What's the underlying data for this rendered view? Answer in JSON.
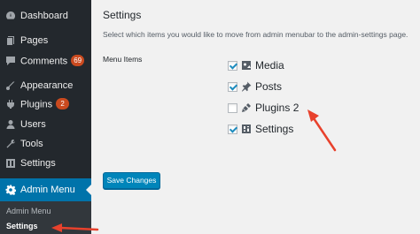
{
  "sidebar": {
    "items": [
      {
        "label": "Dashboard",
        "icon": "dashboard-icon"
      },
      {
        "label": "Pages",
        "icon": "pages-icon"
      },
      {
        "label": "Comments",
        "icon": "comments-icon",
        "badge": "69"
      },
      {
        "label": "Appearance",
        "icon": "appearance-icon"
      },
      {
        "label": "Plugins",
        "icon": "plugins-icon",
        "badge": "2"
      },
      {
        "label": "Users",
        "icon": "users-icon"
      },
      {
        "label": "Tools",
        "icon": "tools-icon"
      },
      {
        "label": "Settings",
        "icon": "settings-icon"
      },
      {
        "label": "Admin Menu",
        "icon": "gear-icon",
        "active": true
      }
    ],
    "submenu": [
      {
        "label": "Admin Menu"
      },
      {
        "label": "Settings",
        "current": true
      }
    ]
  },
  "main": {
    "title": "Settings",
    "description": "Select which items you would like to move from admin menubar to the admin-settings page.",
    "field_label": "Menu Items",
    "menu_items": [
      {
        "label": "Media",
        "checked": true,
        "icon": "media-icon"
      },
      {
        "label": "Posts",
        "checked": true,
        "icon": "pin-icon"
      },
      {
        "label": "Plugins 2",
        "checked": false,
        "icon": "plugin-icon"
      },
      {
        "label": "Settings",
        "checked": true,
        "icon": "settings-box-icon"
      }
    ],
    "save_label": "Save Changes"
  },
  "colors": {
    "sidebar_bg": "#23282d",
    "submenu_bg": "#32373c",
    "accent": "#0073aa",
    "button": "#0085ba",
    "badge": "#ca4a1f",
    "annotation_arrow": "#e8412c"
  }
}
